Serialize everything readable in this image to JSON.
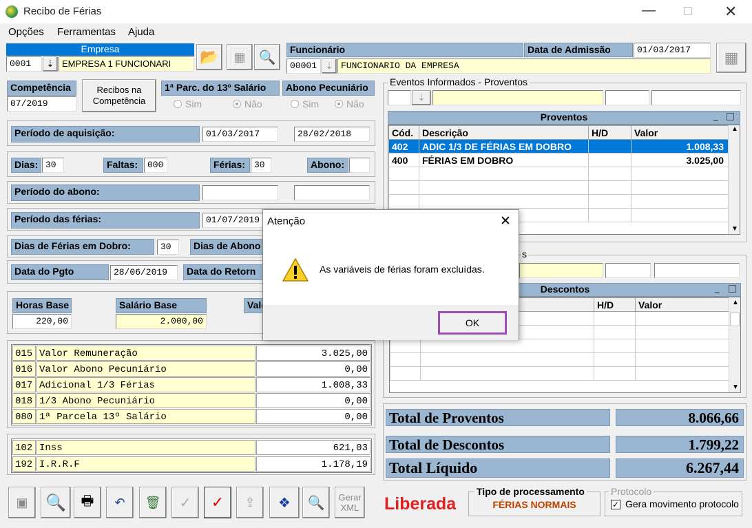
{
  "window": {
    "title": "Recibo de Férias"
  },
  "menu": [
    "Opções",
    "Ferramentas",
    "Ajuda"
  ],
  "empresa": {
    "label": "Empresa",
    "code": "0001",
    "name": "EMPRESA 1 FUNCIONARI"
  },
  "funcionario": {
    "label": "Funcionário",
    "code": "00001",
    "name": "FUNCIONARIO DA EMPRESA",
    "admissao_label": "Data de Admissão",
    "admissao": "01/03/2017"
  },
  "competencia": {
    "label": "Competência",
    "value": "07/2019"
  },
  "recibos_btn": "Recibos na Competência",
  "parcela13": {
    "label": "1ª Parc. do 13º Salário",
    "sim": "Sim",
    "nao": "Não"
  },
  "abono_pec": {
    "label": "Abono Pecuniário",
    "sim": "Sim",
    "nao": "Não"
  },
  "aquisicao": {
    "label": "Período de aquisição:",
    "inicio": "01/03/2017",
    "fim": "28/02/2018"
  },
  "dias": {
    "dias_label": "Dias:",
    "dias": "30",
    "faltas_label": "Faltas:",
    "faltas": "000",
    "ferias_label": "Férias:",
    "ferias": "30",
    "abono_label": "Abono:",
    "abono": ""
  },
  "periodo_abono": {
    "label": "Período do abono:"
  },
  "periodo_ferias": {
    "label": "Período das férias:",
    "inicio": "01/07/2019"
  },
  "dobro": {
    "label": "Dias de Férias em Dobro:",
    "value": "30",
    "abono_label": "Dias de Abono"
  },
  "pgto": {
    "label": "Data do Pgto",
    "value": "28/06/2019",
    "retorno_label": "Data do Retorn"
  },
  "base": {
    "horas_label": "Horas Base",
    "horas": "220,00",
    "salario_label": "Salário Base",
    "salario": "2.000,00",
    "valor_label": "Valo"
  },
  "variaveis": [
    {
      "code": "015",
      "desc": "Valor Remuneração",
      "value": "3.025,00"
    },
    {
      "code": "016",
      "desc": "Valor Abono Pecuniário",
      "value": "0,00"
    },
    {
      "code": "017",
      "desc": "Adicional 1/3 Férias",
      "value": "1.008,33"
    },
    {
      "code": "018",
      "desc": "1/3 Abono Pecuniário",
      "value": "0,00"
    },
    {
      "code": "080",
      "desc": "1ª Parcela 13º Salário",
      "value": "0,00"
    }
  ],
  "impostos": [
    {
      "code": "102",
      "desc": "Inss",
      "value": "621,03"
    },
    {
      "code": "192",
      "desc": "I.R.R.F",
      "value": "1.178,19"
    }
  ],
  "eventos": {
    "label": "Eventos Informados - Proventos",
    "label2": "s"
  },
  "proventos": {
    "title": "Proventos",
    "cols": [
      "Cód.",
      "Descrição",
      "H/D",
      "Valor"
    ],
    "rows": [
      {
        "cod": "402",
        "desc": "ADIC 1/3 DE FÉRIAS EM DOBRO",
        "hd": "",
        "valor": "1.008,33"
      },
      {
        "cod": "400",
        "desc": "FÉRIAS EM DOBRO",
        "hd": "",
        "valor": "3.025,00"
      }
    ]
  },
  "descontos": {
    "title": "Descontos",
    "cols": [
      "H/D",
      "Valor"
    ]
  },
  "totais": {
    "proventos_label": "Total de Proventos",
    "proventos": "8.066,66",
    "descontos_label": "Total de Descontos",
    "descontos": "1.799,22",
    "liquido_label": "Total Líquido",
    "liquido": "6.267,44"
  },
  "toolbar": {
    "gerar_xml": "Gerar XML"
  },
  "status": {
    "liberada": "Liberada",
    "tipo_label": "Tipo de processamento",
    "tipo": "FÉRIAS NORMAIS",
    "protocolo_label": "Protocolo",
    "gera": "Gera movimento protocolo"
  },
  "dialog": {
    "title": "Atenção",
    "message": "As variáveis de férias foram excluídas.",
    "ok": "OK"
  },
  "colors": {
    "label_blue": "#9ab6d0",
    "field_yellow": "#ffffd0",
    "select_blue": "#0078d7",
    "liberada_red": "#e02020",
    "ok_border": "#9b4fb5"
  }
}
